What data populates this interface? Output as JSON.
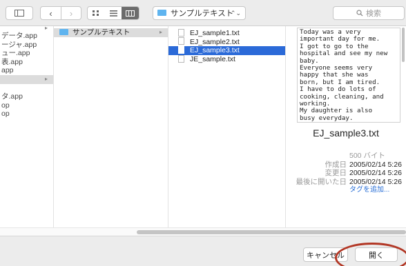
{
  "toolbar": {
    "path_label": "サンプルテキスト",
    "search_placeholder": "検索"
  },
  "column1": {
    "items": [
      "データ.app",
      "ージャ.app",
      "ュー.app",
      "表.app",
      "app",
      "",
      "タ.app",
      "op",
      "op"
    ]
  },
  "column2": {
    "folder": "サンプルテキスト"
  },
  "column3": {
    "files": [
      "EJ_sample1.txt",
      "EJ_sample2.txt",
      "EJ_sample3.txt",
      "JE_sample.txt"
    ],
    "selected_index": 2
  },
  "preview": {
    "text": "Today was a very\nimportant day for me.\nI got to go to the\nhospital and see my new\nbaby.\nEveryone seems very\nhappy that she was\nborn, but I am tired.\nI have to do lots of\ncooking, cleaning, and\nworking.\nMy daughter is also\nbusy everyday.",
    "filename": "EJ_sample3.txt",
    "size": "500 バイト",
    "created_label": "作成日",
    "created": "2005/02/14 5:26",
    "modified_label": "変更日",
    "modified": "2005/02/14 5:26",
    "opened_label": "最後に開いた日",
    "opened": "2005/02/14 5:26",
    "add_tags": "タグを追加..."
  },
  "buttons": {
    "cancel": "キャンセル",
    "open": "開く"
  },
  "colors": {
    "selection": "#2b6ad8",
    "folder": "#5fb4ef",
    "annotation": "#b23624"
  }
}
